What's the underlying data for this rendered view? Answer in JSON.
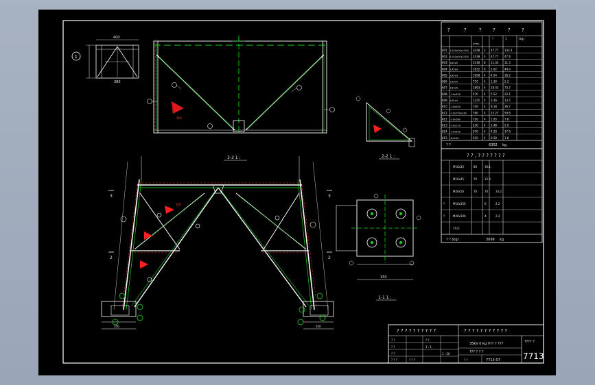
{
  "drawing": {
    "sheet_number": "7713",
    "views": {
      "top_left_label": "1",
      "view_33_label": "3-3 1 :",
      "view_22_label": "2-2 1 :",
      "view_11_label": "1-1 1 :",
      "section_1": "1",
      "section_2": "2",
      "section_3": "3"
    },
    "parts_table": {
      "header_top": [
        "?",
        "?",
        "?",
        "?",
        "?",
        "?"
      ],
      "header_sub": [
        "",
        "",
        "",
        "?",
        "1",
        "(kg)"
      ],
      "header_sub2": [
        "",
        "",
        "(mm)",
        "?",
        "?",
        "?",
        "?"
      ],
      "rows": [
        [
          "601",
          "L140x10x1300",
          "2438",
          "3",
          "47.77",
          "143.3"
        ],
        [
          "602",
          "L140x10x1300",
          "2438",
          "3",
          "47.77",
          "47.8"
        ],
        [
          "603",
          "L63x5",
          "2418",
          "8",
          "11.44",
          "11.5"
        ],
        [
          "604",
          "L45x4",
          "1832",
          "8",
          "5.02",
          "40.0"
        ],
        [
          "605",
          "L45x4",
          "1658",
          "4",
          "4.54",
          "18.2"
        ],
        [
          "606",
          "L50x4",
          "710",
          "4",
          "1.30",
          "5.2"
        ],
        [
          "607",
          "L63x5",
          "1893",
          "4",
          "18.43",
          "73.7"
        ],
        [
          "608",
          "-10x250",
          "470",
          "4",
          "5.52",
          "22.1"
        ],
        [
          "609",
          "L45x4",
          "1225",
          "4",
          "3.36",
          "13.5"
        ],
        [
          "610",
          "-10x540",
          "740",
          "4",
          "9.18",
          "36.7"
        ],
        [
          "611",
          "-10x250x330",
          "760",
          "4",
          "15.27",
          "59.6"
        ],
        [
          "612",
          "-10x180",
          "720",
          "4",
          "1.95",
          "7.8"
        ],
        [
          "613",
          "-10x170",
          "230",
          "4",
          "1.48",
          "5.9"
        ],
        [
          "614",
          "-10x200",
          "670",
          "4",
          "4.20",
          "17.0"
        ],
        [
          "615",
          "-8x150",
          "610",
          "4",
          "0.58",
          "1.8"
        ]
      ],
      "total_label": "? ?",
      "total_value": "6302",
      "total_unit": "kg"
    },
    "bolts_table": {
      "title": "? ? , ? ? ? ? ? ? ?",
      "rows": [
        [
          "",
          "M16x35",
          "60",
          "10.1",
          ""
        ],
        [
          "",
          "M16x45",
          "70",
          "12.3",
          ""
        ],
        [
          "",
          "M20x50",
          "70",
          "70",
          "14.2"
        ],
        [
          "?",
          "M16x350",
          "",
          "6",
          "2.2"
        ],
        [
          "?",
          "M20x300",
          "",
          "4",
          "2.4"
        ],
        [
          "",
          "??(?)",
          "",
          "",
          ""
        ]
      ],
      "total_label": "? ? (kg)",
      "total_value": "3098",
      "total_unit": "kg"
    },
    "title_block": {
      "left_title": "? ? ? ? ? ? ? ? ? ?",
      "right_title": "? ? ? ? ? ? ? ? ? ? ?",
      "row1": [
        "? ?",
        "? ?",
        "? ?"
      ],
      "row2": [
        "? ?",
        "? ?",
        "1 : 1"
      ],
      "row3": [
        "? ?",
        "? ?",
        "1 : 20"
      ],
      "row4": [
        "? ? ?",
        "? ? ?"
      ],
      "project_line1": "35kV 0 kg V?? ? ???",
      "project_line2": "??? ? ? ?",
      "project_line3": "? ?",
      "drawing_no": "7713-07",
      "stamp": "???? ?",
      "big_number": "7713"
    },
    "dims": {
      "w1": "7704",
      "w2": "7480",
      "h1": "5740",
      "dim_a": "400",
      "dim_b": "350",
      "dim_c": "380",
      "dim_d": "150",
      "dim_e": "500"
    }
  }
}
